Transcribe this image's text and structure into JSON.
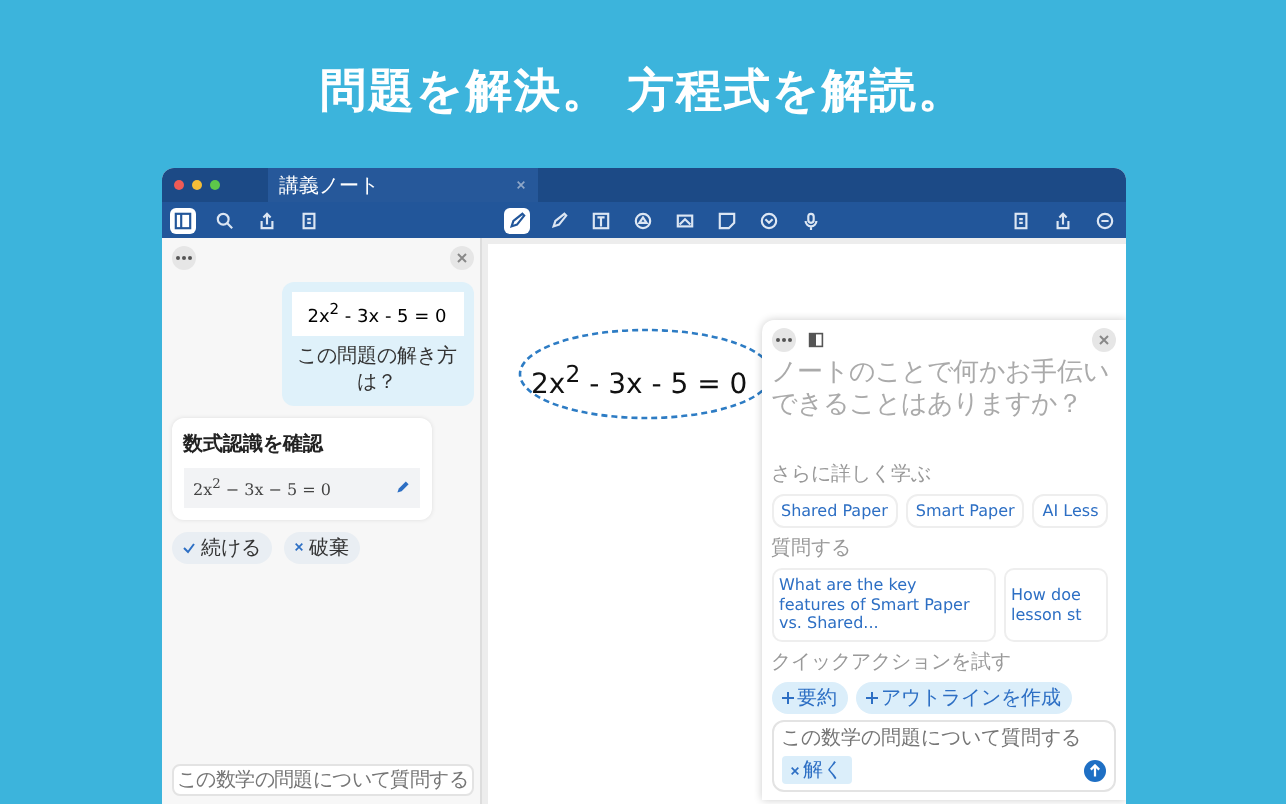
{
  "headline": "問題を解決。 方程式を解読。",
  "window": {
    "tab_title": "講義ノート"
  },
  "toolbar": {
    "tools": [
      {
        "selected": true
      },
      {
        "selected": false
      },
      {
        "selected": false
      },
      {
        "selected": false
      },
      {
        "selected": false
      },
      {
        "selected": false
      },
      {
        "selected": false
      },
      {
        "selected": false
      }
    ]
  },
  "chat": {
    "equation": "2x$^{2}$ - 3x - 5 = 0",
    "question": "この問題の解き方は？",
    "confirm": {
      "title": "数式認識を確認",
      "formula": "2x$^{2}$ − 3x − 5 = 0"
    },
    "actions": [
      {
        "kind": "confirm",
        "label": "続ける"
      },
      {
        "kind": "discard",
        "label": "破棄"
      }
    ],
    "input": {
      "placeholder": "この数学の問題について質問する"
    }
  },
  "canvas": {
    "equation": "2x$^{2}$ - 3x - 5 = 0"
  },
  "assistant": {
    "prompt": "ノートのことで何かお手伝いできることはありますか？",
    "learn_label": "さらに詳しく学ぶ",
    "learn": [
      "Shared Paper",
      "Smart Paper",
      "AI Less"
    ],
    "ask_label": "質問する",
    "questions": [
      "What are the key features of Smart Paper vs. Shared...",
      "How doe lesson st"
    ],
    "quick_label": "クイックアクションを試す",
    "quick": [
      "要約",
      "アウトラインを作成"
    ],
    "input": {
      "placeholder": "この数学の問題について質問する",
      "tag": "解く"
    }
  }
}
